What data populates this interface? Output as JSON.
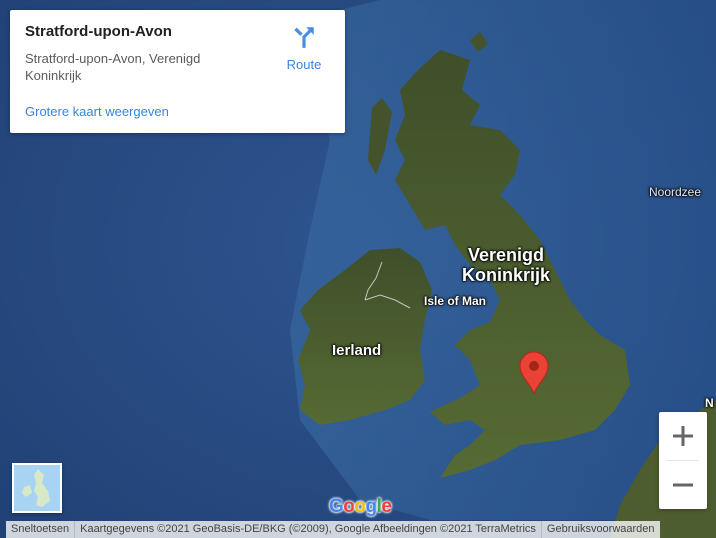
{
  "info_card": {
    "title": "Stratford-upon-Avon",
    "address": "Stratford-upon-Avon, Verenigd Koninkrijk",
    "larger_map_link": "Grotere kaart weergeven",
    "route_label": "Route",
    "route_icon": "directions-icon"
  },
  "map": {
    "labels": {
      "country_uk_line1": "Verenigd",
      "country_uk_line2": "Koninkrijk",
      "isle_of_man": "Isle of Man",
      "ireland": "Ierland",
      "north_sea": "Noordzee",
      "partial_label": "N"
    },
    "marker": {
      "icon": "location-pin-icon",
      "color": "#ea4335"
    },
    "logo_letters": [
      "G",
      "o",
      "o",
      "g",
      "l",
      "e"
    ],
    "logo_colors": [
      "#4285f4",
      "#ea4335",
      "#fbbc05",
      "#4285f4",
      "#34a853",
      "#ea4335"
    ]
  },
  "zoom": {
    "in_icon": "plus-icon",
    "out_icon": "minus-icon"
  },
  "minimap": {
    "icon": "map-type-thumbnail"
  },
  "footer": {
    "shortcuts": "Sneltoetsen",
    "attribution": "Kaartgegevens ©2021 GeoBasis-DE/BKG (©2009), Google Afbeeldingen ©2021 TerraMetrics",
    "terms": "Gebruiksvoorwaarden"
  },
  "colors": {
    "link": "#3a84df",
    "ocean": "#2b4a7e",
    "land": "#4a5a2e"
  }
}
